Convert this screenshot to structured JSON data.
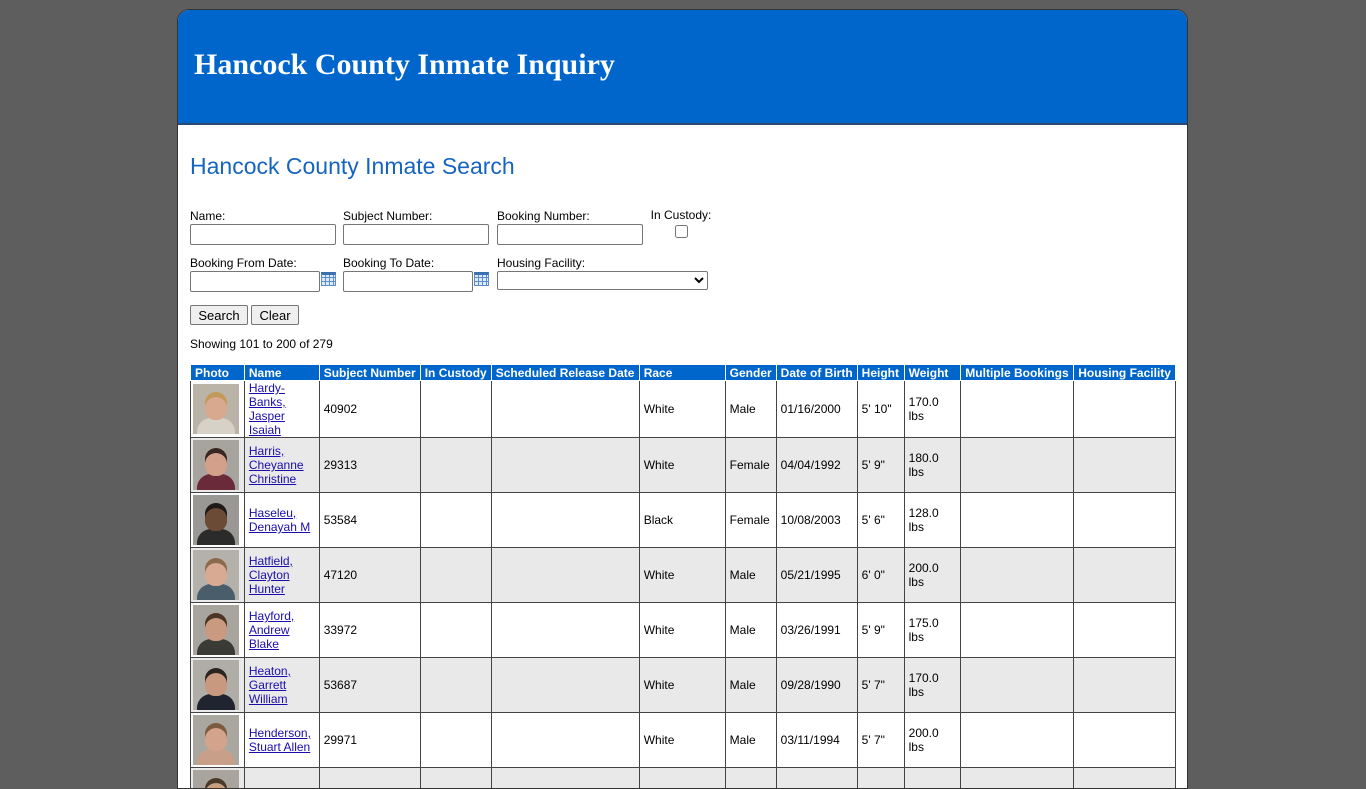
{
  "header": {
    "title": "Hancock County Inmate Inquiry"
  },
  "page": {
    "title": "Hancock County Inmate Search"
  },
  "form": {
    "name_label": "Name:",
    "name_value": "",
    "subject_label": "Subject Number:",
    "subject_value": "",
    "booking_label": "Booking Number:",
    "booking_value": "",
    "custody_label": "In Custody:",
    "from_label": "Booking From Date:",
    "from_value": "",
    "to_label": "Booking To Date:",
    "to_value": "",
    "facility_label": "Housing Facility:",
    "facility_selected": "",
    "search_label": "Search",
    "clear_label": "Clear"
  },
  "status": {
    "text": "Showing 101 to 200 of 279"
  },
  "table": {
    "columns": [
      "Photo",
      "Name",
      "Subject Number",
      "In Custody",
      "Scheduled Release Date",
      "Race",
      "Gender",
      "Date of Birth",
      "Height",
      "Weight",
      "Multiple Bookings",
      "Housing Facility"
    ],
    "rows": [
      {
        "name": "Hardy-Banks, Jasper Isaiah",
        "subject": "40902",
        "custody": "",
        "release": "",
        "race": "White",
        "gender": "Male",
        "dob": "01/16/2000",
        "height": "5' 10\"",
        "weight": "170.0 lbs",
        "multiple": "",
        "facility": "",
        "photo": {
          "bg": "#b9b3a8",
          "skin": "#d9a98f",
          "shirt": "#d7d2c8",
          "hair": "#c49a5a"
        }
      },
      {
        "name": "Harris, Cheyanne Christine",
        "subject": "29313",
        "custody": "",
        "release": "",
        "race": "White",
        "gender": "Female",
        "dob": "04/04/1992",
        "height": "5' 9\"",
        "weight": "180.0 lbs",
        "multiple": "",
        "facility": "",
        "photo": {
          "bg": "#a7a39d",
          "skin": "#d3a08c",
          "shirt": "#6b2a3a",
          "hair": "#3a2620"
        }
      },
      {
        "name": "Haseleu, Denayah M",
        "subject": "53584",
        "custody": "",
        "release": "",
        "race": "Black",
        "gender": "Female",
        "dob": "10/08/2003",
        "height": "5' 6\"",
        "weight": "128.0 lbs",
        "multiple": "",
        "facility": "",
        "photo": {
          "bg": "#9a9894",
          "skin": "#6b4a36",
          "shirt": "#2b2b2b",
          "hair": "#1e1a18"
        }
      },
      {
        "name": "Hatfield, Clayton Hunter",
        "subject": "47120",
        "custody": "",
        "release": "",
        "race": "White",
        "gender": "Male",
        "dob": "05/21/1995",
        "height": "6' 0\"",
        "weight": "200.0 lbs",
        "multiple": "",
        "facility": "",
        "photo": {
          "bg": "#b4b1aa",
          "skin": "#d8a993",
          "shirt": "#4a5d6a",
          "hair": "#8a6a4a"
        }
      },
      {
        "name": "Hayford, Andrew Blake",
        "subject": "33972",
        "custody": "",
        "release": "",
        "race": "White",
        "gender": "Male",
        "dob": "03/26/1991",
        "height": "5' 9\"",
        "weight": "175.0 lbs",
        "multiple": "",
        "facility": "",
        "photo": {
          "bg": "#a8a59e",
          "skin": "#c99a80",
          "shirt": "#3a3a36",
          "hair": "#4a3526"
        }
      },
      {
        "name": "Heaton, Garrett William",
        "subject": "53687",
        "custody": "",
        "release": "",
        "race": "White",
        "gender": "Male",
        "dob": "09/28/1990",
        "height": "5' 7\"",
        "weight": "170.0 lbs",
        "multiple": "",
        "facility": "",
        "photo": {
          "bg": "#b0ada6",
          "skin": "#c9997f",
          "shirt": "#1f2430",
          "hair": "#2a2420"
        }
      },
      {
        "name": "Henderson, Stuart Allen",
        "subject": "29971",
        "custody": "",
        "release": "",
        "race": "White",
        "gender": "Male",
        "dob": "03/11/1994",
        "height": "5' 7\"",
        "weight": "200.0 lbs",
        "multiple": "",
        "facility": "",
        "photo": {
          "bg": "#aaa7a0",
          "skin": "#d4a38c",
          "shirt": "#c8a08a",
          "hair": "#7a5a40"
        }
      },
      {
        "name": "",
        "subject": "",
        "custody": "",
        "release": "",
        "race": "",
        "gender": "",
        "dob": "",
        "height": "",
        "weight": "",
        "multiple": "",
        "facility": "",
        "photo": {
          "bg": "#a9a59e",
          "skin": "#c9a080",
          "shirt": "#555",
          "hair": "#4a3a2a"
        }
      }
    ]
  }
}
